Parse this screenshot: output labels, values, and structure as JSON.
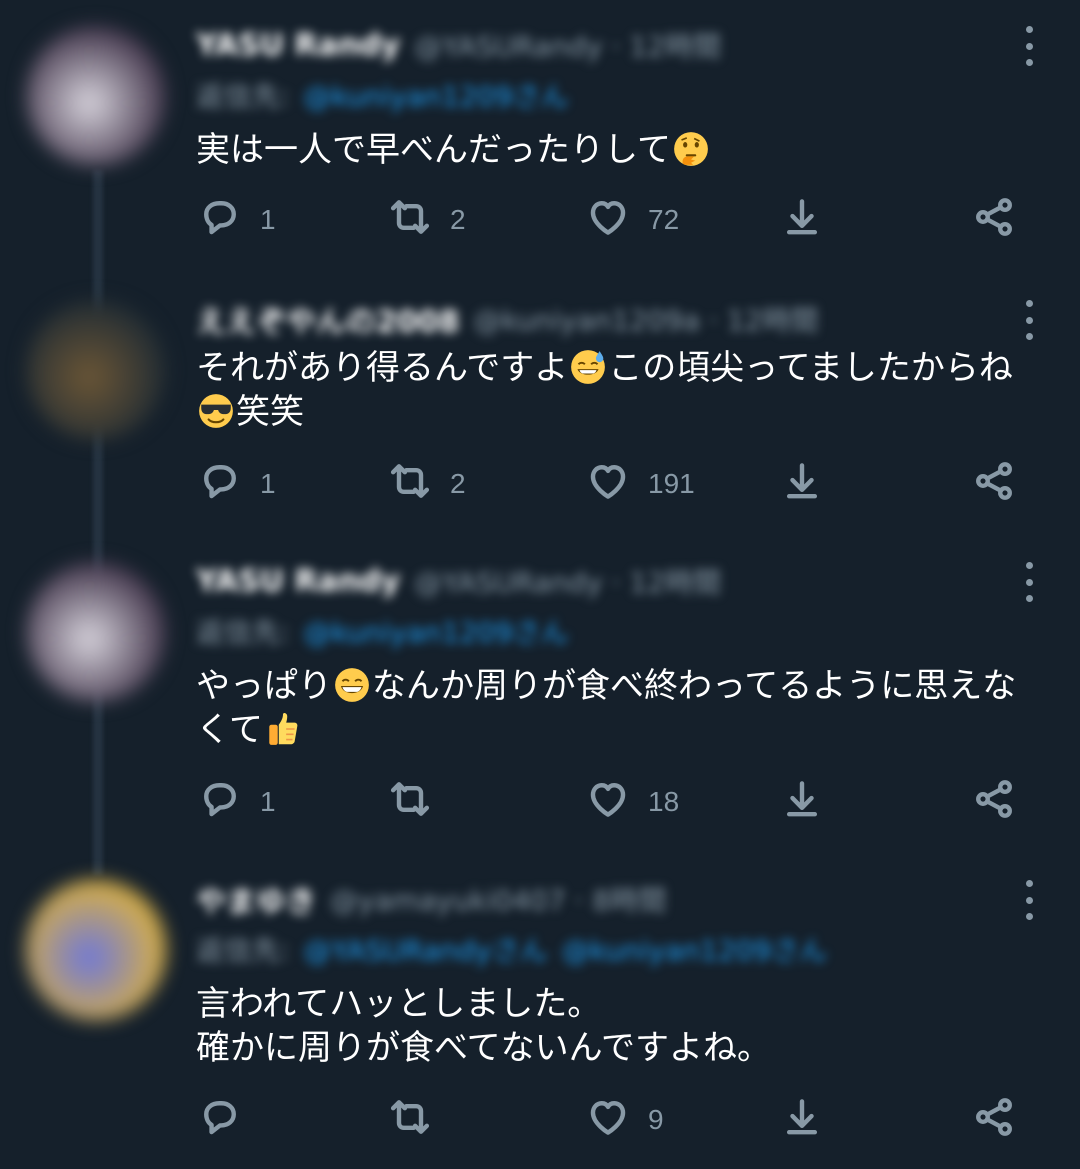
{
  "tweets": [
    {
      "name": "YASU Randy",
      "handle": "@YASURandy · 12時間",
      "reply_label": "返信先:",
      "reply_mentions": [
        "@kuniyan1209さん"
      ],
      "text_parts": [
        "実は一人で早べんだったりして",
        "🤔"
      ],
      "replies": "1",
      "retweets": "2",
      "likes": "72",
      "avatar_colors": [
        "#d7d3dc",
        "#3b2e44"
      ]
    },
    {
      "name": "ええぞやんの2008",
      "handle": "@kuniyan1209a · 12時間",
      "reply_label": "",
      "reply_mentions": [],
      "text_parts": [
        "それがあり得るんですよ",
        "😅",
        "この頃尖ってましたからね\n",
        "😎",
        "笑笑"
      ],
      "replies": "1",
      "retweets": "2",
      "likes": "191",
      "avatar_colors": [
        "#6b5636",
        "#1e2a33"
      ]
    },
    {
      "name": "YASU Randy",
      "handle": "@YASURandy · 12時間",
      "reply_label": "返信先:",
      "reply_mentions": [
        "@kuniyan1209さん"
      ],
      "text_parts": [
        "やっぱり",
        "😁",
        "なんか周りが食べ終わってるように思えな\nくて",
        "👍"
      ],
      "replies": "1",
      "retweets": "",
      "likes": "18",
      "avatar_colors": [
        "#d7d3dc",
        "#3b2e44"
      ]
    },
    {
      "name": "やまゆき",
      "handle": "@yamayuki0407 · 8時間",
      "reply_label": "返信先:",
      "reply_mentions": [
        "@YASURandyさん",
        "@kuniyan1209さん"
      ],
      "text_parts": [
        "言われてハッとしました。\n確かに周りが食べてないんですよね。"
      ],
      "replies": "",
      "retweets": "",
      "likes": "9",
      "avatar_colors": [
        "#6f78d8",
        "#e0b43a"
      ]
    }
  ],
  "icons": {
    "reply": "speech-bubble-icon",
    "retweet": "retweet-arrows-icon",
    "like": "heart-icon",
    "share": "download-arrow-icon",
    "more_share": "share-nodes-icon",
    "more": "vertical-dots-icon"
  },
  "colors": {
    "background": "#15202b",
    "muted": "#8899a6",
    "accent": "#1d9bf0"
  }
}
